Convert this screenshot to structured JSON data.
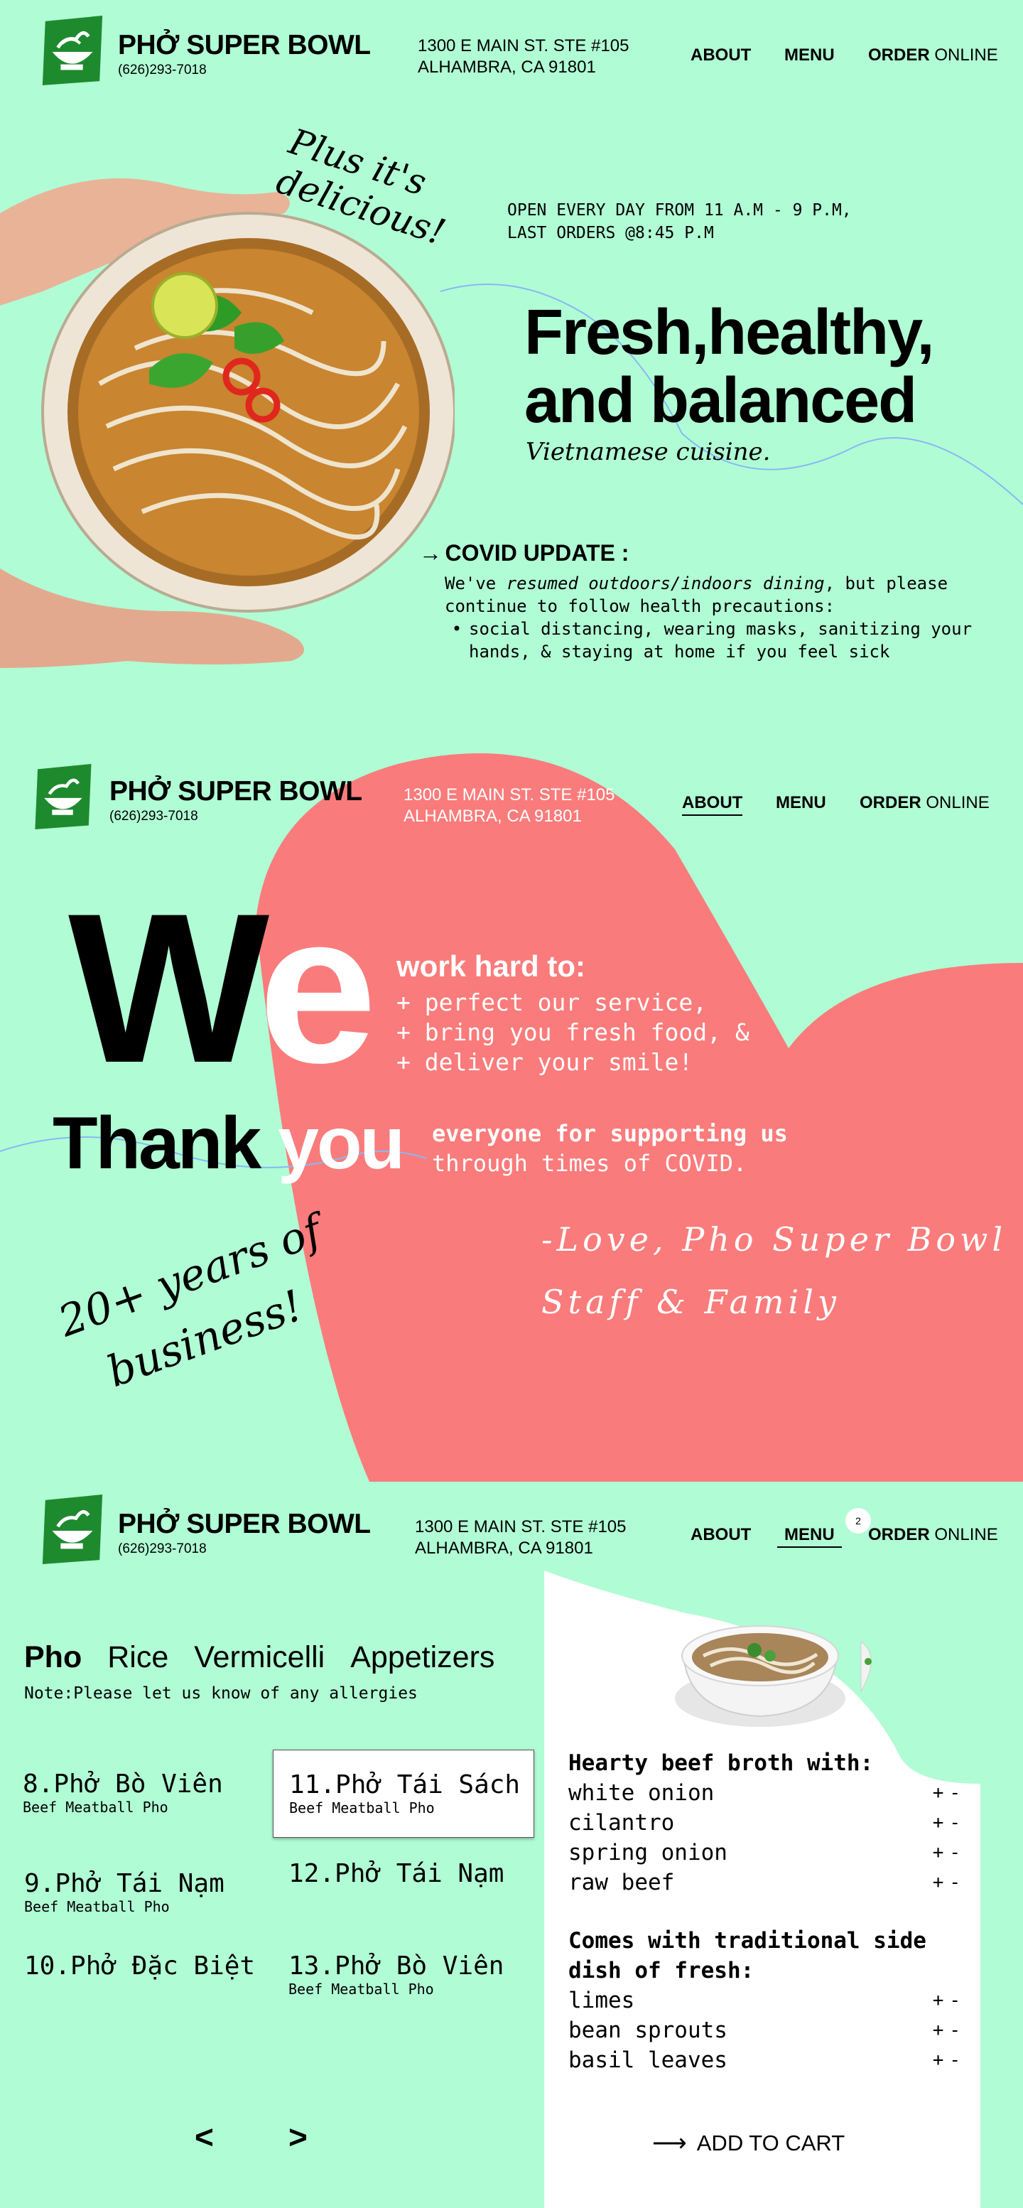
{
  "brand": {
    "name": "PHỞ SUPER BOWL",
    "phone": "(626)293-7018",
    "address_line1": "1300 E MAIN ST. STE #105",
    "address_line2": "ALHAMBRA, CA 91801"
  },
  "nav": {
    "about": "ABOUT",
    "menu": "MENU",
    "order_bold": "ORDER",
    "order_light": "ONLINE"
  },
  "hero": {
    "script_line1": "Plus it's",
    "script_line2": "delicious!",
    "hours_line1": "OPEN EVERY DAY FROM 11 A.M - 9 P.M,",
    "hours_line2": "LAST ORDERS @8:45 P.M",
    "headline_line1": "Fresh,healthy,",
    "headline_line2": "and balanced",
    "subheadline": "Vietnamese cuisine.",
    "covid_arrow": "→",
    "covid_title": "COVID UPDATE :",
    "covid_text_1": "We've ",
    "covid_text_italic": "resumed outdoors/indoors dining",
    "covid_text_2": ", but please continue to follow health precautions:",
    "covid_bullet": "social distancing, wearing masks, sanitizing your hands, & staying at home if you feel sick"
  },
  "about": {
    "we_black": "W",
    "we_white": "e",
    "work_hard": "work hard to:",
    "points": [
      "+ perfect our service,",
      "+ bring you fresh food, &",
      "+ deliver your smile!"
    ],
    "thank_black": "Thank",
    "thank_white": "you",
    "support_line1": "everyone for supporting us",
    "support_line2": "through times of COVID.",
    "signoff_line1": "-Love, Pho Super Bowl",
    "signoff_line2": "Staff & Family",
    "years_line1": "20+ years of",
    "years_line2": "business!"
  },
  "menu": {
    "cart_count": "2",
    "categories": [
      "Pho",
      "Rice",
      "Vermicelli",
      "Appetizers"
    ],
    "note": "Note:Please let us know of any allergies",
    "items": [
      {
        "name": "8.Phở Bò Viên",
        "sub": "Beef Meatball Pho"
      },
      {
        "name": "11.Phở Tái Sách",
        "sub": "Beef Meatball Pho"
      },
      {
        "name": "9.Phở Tái Nạm",
        "sub": "Beef Meatball Pho"
      },
      {
        "name": "12.Phở Tái Nạm",
        "sub": ""
      },
      {
        "name": "10.Phở Đặc Biệt",
        "sub": ""
      },
      {
        "name": "13.Phở Bò Viên",
        "sub": "Beef Meatball Pho"
      }
    ],
    "prev": "<",
    "next": ">",
    "broth_title": "Hearty beef broth with:",
    "broth": [
      "white onion",
      "cilantro",
      "spring onion",
      "raw beef"
    ],
    "sides_title_1": "Comes with traditional side",
    "sides_title_2": "dish of fresh:",
    "sides": [
      "limes",
      "bean sprouts",
      "basil leaves"
    ],
    "plus": "+",
    "minus": "-",
    "cart_arrow": "⟶",
    "add_to_cart": "ADD TO CART"
  },
  "colors": {
    "background": "#b0fcd5",
    "coral": "#fa7b7b",
    "logo_green": "#1e8a2e",
    "wave_blue": "#8ab8f4"
  }
}
